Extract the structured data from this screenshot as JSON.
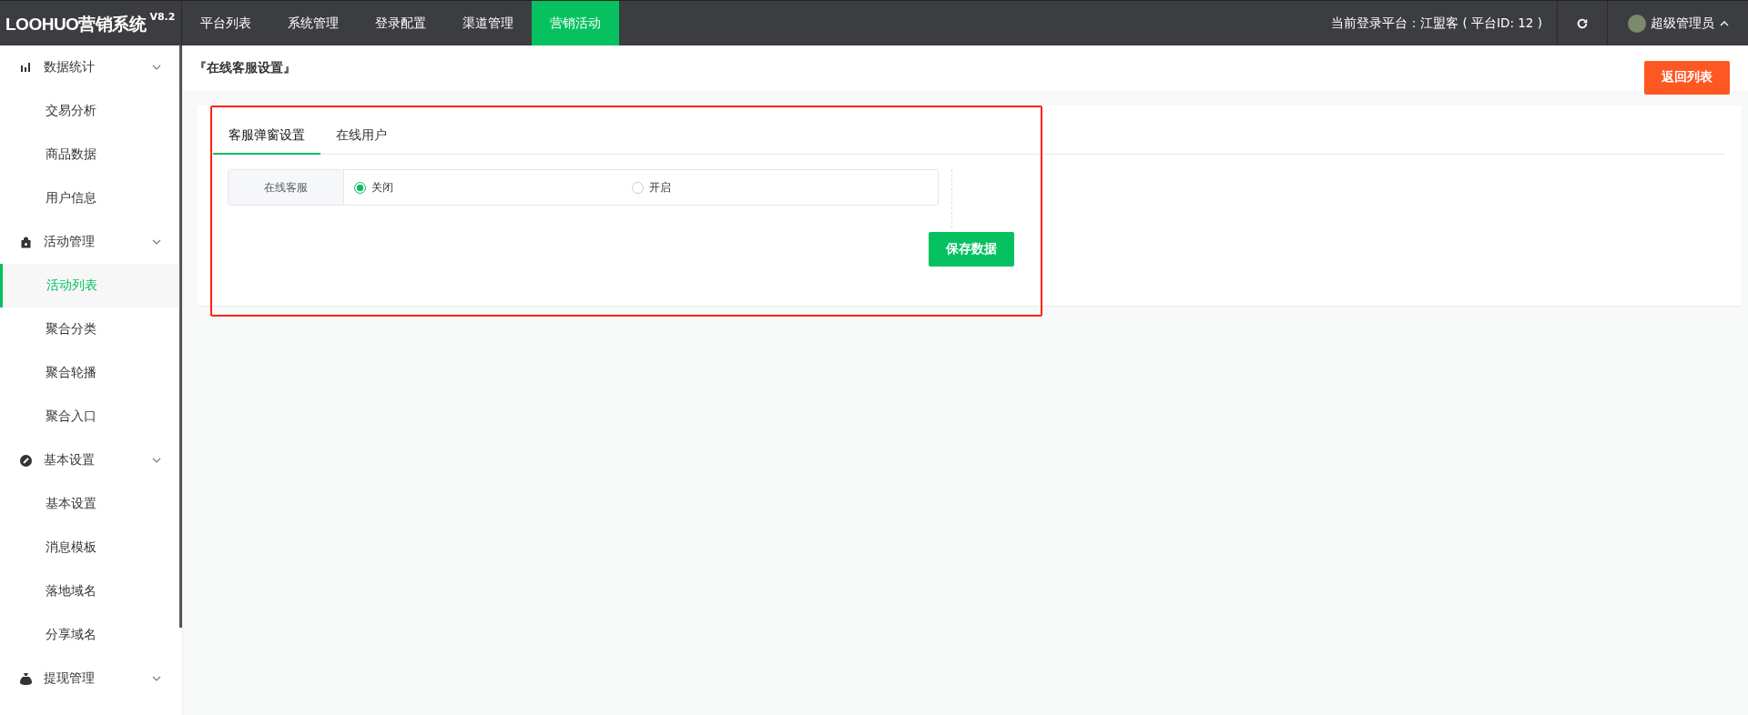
{
  "logo": {
    "name": "LOOHUO营销系统",
    "version": "V8.2"
  },
  "nav": [
    {
      "label": "平台列表",
      "selected": false
    },
    {
      "label": "系统管理",
      "selected": false
    },
    {
      "label": "登录配置",
      "selected": false
    },
    {
      "label": "渠道管理",
      "selected": false
    },
    {
      "label": "营销活动",
      "selected": true
    }
  ],
  "platform_info": "当前登录平台：江盟客 ( 平台ID: 12 )",
  "user": {
    "name": "超级管理员"
  },
  "sidebar": [
    {
      "label": "数据统计",
      "expanded": true,
      "children": [
        {
          "label": "交易分析",
          "selected": false
        },
        {
          "label": "商品数据",
          "selected": false
        },
        {
          "label": "用户信息",
          "selected": false
        }
      ]
    },
    {
      "label": "活动管理",
      "expanded": true,
      "children": [
        {
          "label": "活动列表",
          "selected": true
        },
        {
          "label": "聚合分类",
          "selected": false
        },
        {
          "label": "聚合轮播",
          "selected": false
        },
        {
          "label": "聚合入口",
          "selected": false
        }
      ]
    },
    {
      "label": "基本设置",
      "expanded": true,
      "children": [
        {
          "label": "基本设置",
          "selected": false
        },
        {
          "label": "消息模板",
          "selected": false
        },
        {
          "label": "落地域名",
          "selected": false
        },
        {
          "label": "分享域名",
          "selected": false
        }
      ]
    },
    {
      "label": "提现管理",
      "expanded": true
    }
  ],
  "page_title": "『在线客服设置』",
  "back_button": "返回列表",
  "tabs": [
    {
      "label": "客服弹窗设置",
      "selected": true
    },
    {
      "label": "在线用户",
      "selected": false
    }
  ],
  "form": {
    "label": "在线客服",
    "options": [
      {
        "label": "关闭",
        "selected": true
      },
      {
        "label": "开启",
        "selected": false
      }
    ]
  },
  "save_button": "保存数据"
}
